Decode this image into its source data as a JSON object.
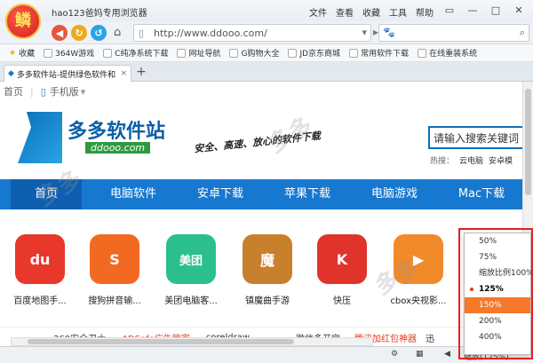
{
  "window": {
    "title": "hao123爸妈专用浏览器",
    "logo_text": "鳞"
  },
  "menu": [
    "文件",
    "查看",
    "收藏",
    "工具",
    "帮助"
  ],
  "address": {
    "url": "http://www.ddooo.com/"
  },
  "bookmarks": [
    "收藏",
    "364W游戏",
    "C纯净系统下载",
    "网址导航",
    "G购物大全",
    "JD京东商城",
    "常用软件下载",
    "在线重装系统"
  ],
  "tab": {
    "title": "多多软件站-提供绿色软件和"
  },
  "page": {
    "top_links": [
      "首页",
      "手机版"
    ],
    "brand_name": "多多软件站",
    "brand_domain": "ddooo.com",
    "slogan": "安全、高速、放心的软件下载",
    "search_placeholder": "请输入搜索关键词",
    "hot_label": "热搜：",
    "hot_items": [
      "云电脑",
      "安卓模"
    ],
    "main_nav": [
      "首页",
      "电脑软件",
      "安卓下载",
      "苹果下载",
      "电脑游戏",
      "Mac下载"
    ],
    "apps": [
      {
        "label": "百度地图手...",
        "icon": "du",
        "color": "#e8382b"
      },
      {
        "label": "搜狗拼音输...",
        "icon": "S",
        "color": "#f26a21"
      },
      {
        "label": "美团电脑客...",
        "icon": "美团",
        "color": "#2bbf8f"
      },
      {
        "label": "镇魔曲手游",
        "icon": "魔",
        "color": "#c9802c"
      },
      {
        "label": "快压",
        "icon": "K",
        "color": "#e0342b"
      },
      {
        "label": "cbox央视影...",
        "icon": "▶",
        "color": "#f08a2a"
      }
    ],
    "bottom_row": [
      "360安全卫士",
      "ADSafe广告管家",
      "coreldraw",
      "微信多开宝",
      "腾讯加红包神器",
      "迅"
    ]
  },
  "zoom_menu": {
    "options": [
      "50%",
      "75%",
      "缩放比例100%",
      "125%",
      "150%",
      "200%",
      "400%"
    ],
    "selected": "125%",
    "highlighted": "150%"
  },
  "status": {
    "zoom_label": "缩放(125%)"
  },
  "colors": {
    "nav_blue": "#1778cf",
    "highlight_orange": "#f6782a",
    "frame_red": "#e62020"
  }
}
